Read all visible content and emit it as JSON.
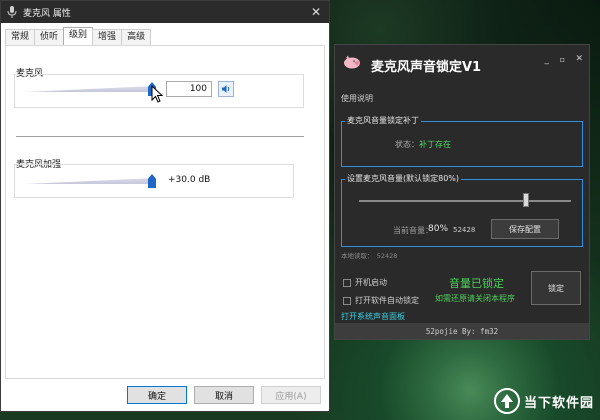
{
  "dialog": {
    "title": "麦克风 属性",
    "close_glyph": "✕",
    "tabs": [
      "常规",
      "侦听",
      "级别",
      "增强",
      "高级"
    ],
    "active_tab": "级别",
    "mic_group": {
      "label": "麦克风",
      "value": "100",
      "level_fraction": 1.0
    },
    "boost_group": {
      "label": "麦克风加强",
      "value": "+30.0 dB",
      "level_fraction": 1.0
    },
    "buttons": {
      "ok": "确定",
      "cancel": "取消",
      "apply": "应用(A)"
    }
  },
  "tool": {
    "title": "麦克风声音锁定V1",
    "window_controls": {
      "minimize": "_",
      "maximize": "▫",
      "close": "✕"
    },
    "menu": "使用说明",
    "patch_box": {
      "title": "麦克风音量锁定补丁",
      "status_label": "状态：",
      "status_value": "补丁存在"
    },
    "volume_box": {
      "title": "设置麦克风音量(默认锁定80%)",
      "slider_fraction": 0.8,
      "current_label": "当前音量：",
      "current_value": "80%",
      "raw_value": "52428",
      "save_button": "保存配置"
    },
    "local_read": "本地读取：　52428",
    "autostart_label": "开机启动",
    "autolock_label": "打开软件自动锁定",
    "locked_text": "音量已锁定",
    "hint_text": "如需还原请关闭本程序",
    "lock_button": "锁定",
    "open_panel_link": "打开系统声音面板",
    "footer": "52pojie By: fm32"
  },
  "watermark": {
    "text": "当下软件园"
  }
}
